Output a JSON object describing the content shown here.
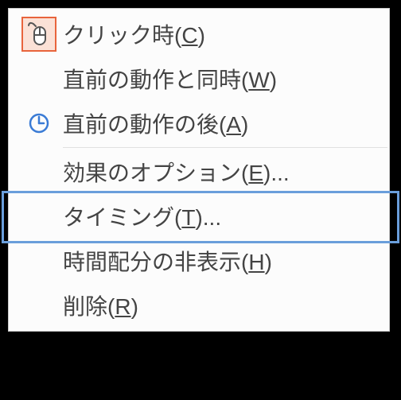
{
  "menu": {
    "items": [
      {
        "pre": "クリック時(",
        "mn": "C",
        "post": ")",
        "icon": "mouse-click-icon",
        "active_icon": true
      },
      {
        "pre": "直前の動作と同時(",
        "mn": "W",
        "post": ")",
        "icon": null
      },
      {
        "pre": "直前の動作の後(",
        "mn": "A",
        "post": ")",
        "icon": "clock-icon"
      },
      {
        "pre": "効果のオプション(",
        "mn": "E",
        "post": ")...",
        "icon": null
      },
      {
        "pre": "タイミング(",
        "mn": "T",
        "post": ")...",
        "icon": null,
        "highlighted": true
      },
      {
        "pre": "時間配分の非表示(",
        "mn": "H",
        "post": ")",
        "icon": null
      },
      {
        "pre": "削除(",
        "mn": "R",
        "post": ")",
        "icon": null
      }
    ]
  }
}
